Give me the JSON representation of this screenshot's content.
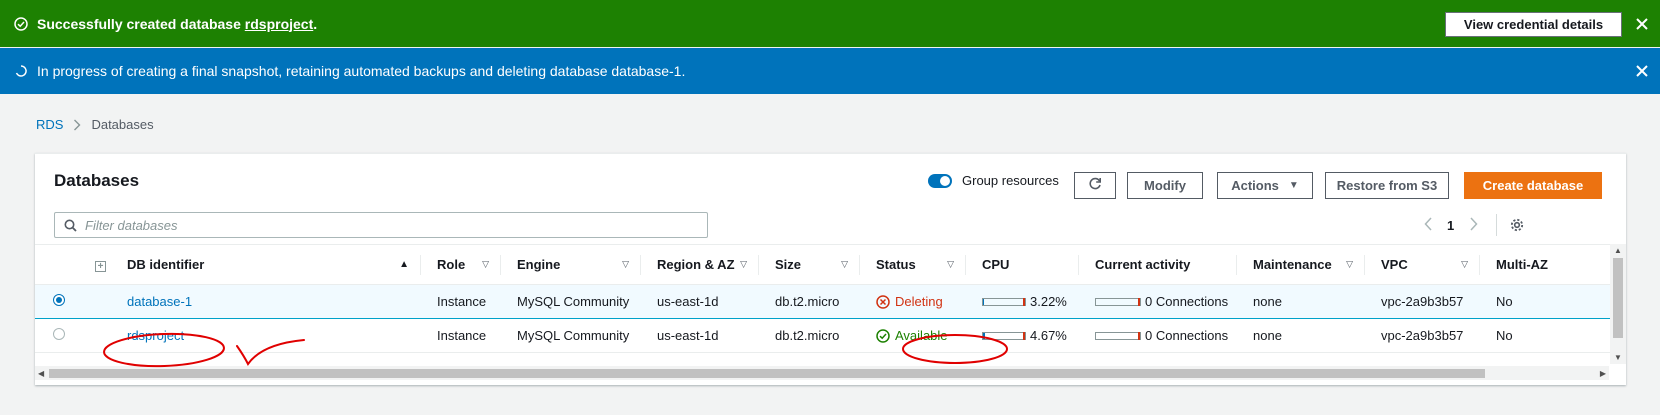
{
  "flash_success": {
    "text_before": "Successfully created database ",
    "link": "rdsproject",
    "text_after": ".",
    "button_label": "View credential details",
    "colors": {
      "background": "#1d8102"
    }
  },
  "flash_info": {
    "text": "In progress of creating a final snapshot, retaining automated backups and deleting database database-1.",
    "colors": {
      "background": "#0073bb"
    }
  },
  "breadcrumb": {
    "items": [
      "RDS",
      "Databases"
    ]
  },
  "panel": {
    "title": "Databases",
    "group_resources_label": "Group resources",
    "group_resources_on": true,
    "buttons": {
      "modify": "Modify",
      "actions": "Actions",
      "restore": "Restore from S3",
      "create": "Create database"
    },
    "filter_placeholder": "Filter databases",
    "page_number": "1"
  },
  "table": {
    "columns": [
      "DB identifier",
      "Role",
      "Engine",
      "Region & AZ",
      "Size",
      "Status",
      "CPU",
      "Current activity",
      "Maintenance",
      "VPC",
      "Multi-AZ"
    ],
    "rows": [
      {
        "id": "database-1",
        "role": "Instance",
        "engine": "MySQL Community",
        "region": "us-east-1d",
        "size": "db.t2.micro",
        "status": "Deleting",
        "cpu": "3.22%",
        "cpu_fraction": 0.0322,
        "activity": "0 Connections",
        "maintenance": "none",
        "vpc": "vpc-2a9b3b57",
        "multi_az": "No",
        "selected": true
      },
      {
        "id": "rdsproject",
        "role": "Instance",
        "engine": "MySQL Community",
        "region": "us-east-1d",
        "size": "db.t2.micro",
        "status": "Available",
        "cpu": "4.67%",
        "cpu_fraction": 0.0467,
        "activity": "0 Connections",
        "maintenance": "none",
        "vpc": "vpc-2a9b3b57",
        "multi_az": "No",
        "selected": false
      }
    ]
  },
  "colors": {
    "accent": "#0073bb",
    "primary_button": "#ec7211",
    "status_deleting": "#d13212",
    "status_available": "#1d8102",
    "annotation": "#e00000"
  },
  "icons": {
    "success": "check-circle-icon",
    "info": "spinner-icon",
    "close": "close-icon",
    "refresh": "refresh-icon",
    "search": "search-icon",
    "settings": "gear-icon"
  }
}
